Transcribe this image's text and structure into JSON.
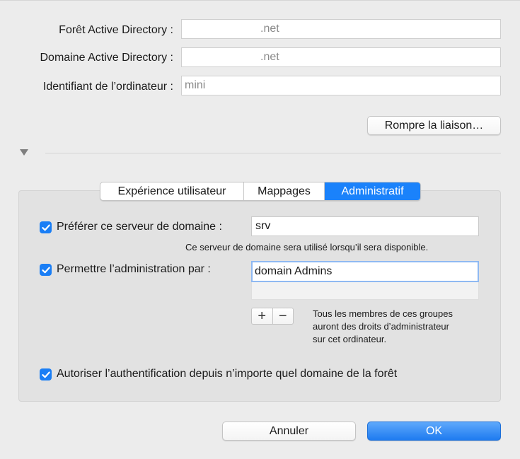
{
  "fields": {
    "forest": {
      "label": "Forêt Active Directory :",
      "value": ".net"
    },
    "domain": {
      "label": "Domaine Active Directory :",
      "value": ".net"
    },
    "computer_id": {
      "label": "Identifiant de l’ordinateur :",
      "value": "mini"
    }
  },
  "unbind_button": "Rompre la liaison…",
  "tabs": [
    {
      "label": "Expérience utilisateur",
      "active": false
    },
    {
      "label": "Mappages",
      "active": false
    },
    {
      "label": "Administratif",
      "active": true
    }
  ],
  "admin": {
    "prefer_server": {
      "checked": true,
      "label": "Préférer ce serveur de domaine :",
      "value": "srv",
      "hint": "Ce serveur de domaine sera utilisé lorsqu’il sera disponible."
    },
    "allow_admin": {
      "checked": true,
      "label": "Permettre l’administration par :",
      "entries": [
        "domain Admins"
      ],
      "add_symbol": "+",
      "remove_symbol": "−",
      "hint": "Tous les membres de ces groupes auront des droits d’administrateur sur cet ordinateur."
    },
    "allow_auth": {
      "checked": true,
      "label": "Autoriser l’authentification depuis n’importe quel domaine de la forêt"
    }
  },
  "footer": {
    "cancel_label": "Annuler",
    "ok_label": "OK"
  },
  "colors": {
    "accent": "#1a82fb",
    "window_bg": "#ececec",
    "panel_bg": "#e2e2e2"
  },
  "icons": {
    "checkbox": "checkmark-icon",
    "disclosure": "disclosure-triangle-down-icon"
  }
}
